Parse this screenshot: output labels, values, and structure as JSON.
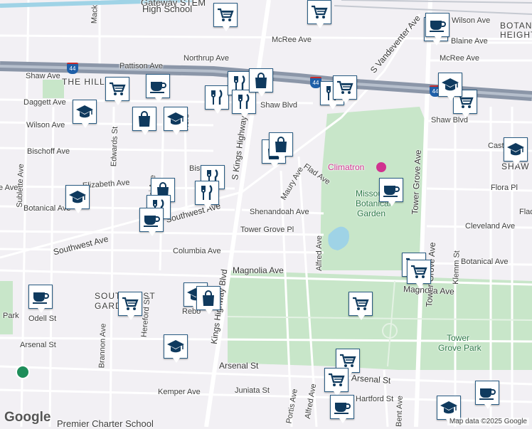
{
  "colors": {
    "background": "#f2f0f4",
    "road": "#ffffff",
    "highway": "#8b96a8",
    "park": "#c8e6c9",
    "pin_border": "#2b5d84",
    "icon": "#0f3a5e",
    "water": "#9fd3e6"
  },
  "neighborhood_labels": [
    {
      "text": "THE HILL"
    },
    {
      "text": "SOUTHWEST"
    },
    {
      "text": "GARDEN"
    },
    {
      "text": "BOTAN"
    },
    {
      "text": "HEIGHT"
    },
    {
      "text": "SHAW"
    }
  ],
  "street_labels": [
    {
      "text": "McRee Ave"
    },
    {
      "text": "Northrup Ave"
    },
    {
      "text": "Pattison Ave"
    },
    {
      "text": "Shaw Ave"
    },
    {
      "text": "Daggett Ave"
    },
    {
      "text": "Wilson Ave"
    },
    {
      "text": "Bischoff Ave"
    },
    {
      "text": "Elizabeth Ave"
    },
    {
      "text": "Botanical Ave"
    },
    {
      "text": "Southwest Ave"
    },
    {
      "text": "Southwest Ave"
    },
    {
      "text": "Columbia Ave"
    },
    {
      "text": "Tower Grove Pl"
    },
    {
      "text": "Shenandoah Ave"
    },
    {
      "text": "Magnolia Ave"
    },
    {
      "text": "Magnolia Ave"
    },
    {
      "text": "Arsenal St"
    },
    {
      "text": "Arsenal St"
    },
    {
      "text": "Arsenal St"
    },
    {
      "text": "Kemper Ave"
    },
    {
      "text": "Juniata St"
    },
    {
      "text": "Odell St"
    },
    {
      "text": "Flad Ave"
    },
    {
      "text": "Maury Ave"
    },
    {
      "text": "Shaw Blvd"
    },
    {
      "text": "Shaw Blvd"
    },
    {
      "text": "McRee Ave"
    },
    {
      "text": "Flora Pl"
    },
    {
      "text": "Cleveland Ave"
    },
    {
      "text": "Botanical Ave"
    },
    {
      "text": "Alfred Ave"
    },
    {
      "text": "Alfred Ave"
    },
    {
      "text": "Portis Ave"
    },
    {
      "text": "Hereford St"
    },
    {
      "text": "Edwards St"
    },
    {
      "text": "Brannon Ave"
    },
    {
      "text": "Marconi Ave"
    },
    {
      "text": "Sublette Ave"
    },
    {
      "text": "S Kings Highway"
    },
    {
      "text": "Kings Highway Blvd"
    },
    {
      "text": "Tower Grove Ave"
    },
    {
      "text": "Tower Grove Ave"
    },
    {
      "text": "S Vandeventer Ave"
    },
    {
      "text": "Klemm St"
    },
    {
      "text": "Bent Ave"
    },
    {
      "text": "Hartford St"
    },
    {
      "text": "Wilson Ave"
    },
    {
      "text": "Blaine Ave"
    },
    {
      "text": "Rebo"
    },
    {
      "text": "Bis"
    },
    {
      "text": "Here"
    },
    {
      "text": "Mack"
    },
    {
      "text": "Cast"
    },
    {
      "text": "Flad"
    },
    {
      "text": "Park"
    },
    {
      "text": "e Ave"
    },
    {
      "text": "e Ave"
    }
  ],
  "park_labels": [
    {
      "text": "Missouri"
    },
    {
      "text": "Botanical"
    },
    {
      "text": "Garden"
    },
    {
      "text": "Tower"
    },
    {
      "text": "Grove Park"
    }
  ],
  "poi_labels": [
    {
      "text": "Climatron"
    }
  ],
  "top_labels": [
    {
      "text": "Gateway STEM"
    },
    {
      "text": "High School"
    }
  ],
  "bottom_labels": [
    {
      "text": "Premier Charter School"
    }
  ],
  "interstate": {
    "number": "44"
  },
  "pins": [
    {
      "icon": "cart-icon"
    },
    {
      "icon": "cart-icon"
    },
    {
      "icon": "cart-icon"
    },
    {
      "icon": "coffee-icon"
    },
    {
      "icon": "cart-icon"
    },
    {
      "icon": "coffee-icon"
    },
    {
      "icon": "school-icon"
    },
    {
      "icon": "bag-icon"
    },
    {
      "icon": "school-icon"
    },
    {
      "icon": "fork-knife-icon"
    },
    {
      "icon": "fork-knife-icon"
    },
    {
      "icon": "fork-knife-icon"
    },
    {
      "icon": "bag-icon"
    },
    {
      "icon": "fork-knife-icon"
    },
    {
      "icon": "cart-icon"
    },
    {
      "icon": "school-icon"
    },
    {
      "icon": "cart-icon"
    },
    {
      "icon": "coffee-icon"
    },
    {
      "icon": "bag-icon"
    },
    {
      "icon": "bag-icon"
    },
    {
      "icon": "fork-knife-icon"
    },
    {
      "icon": "bag-icon"
    },
    {
      "icon": "fork-knife-icon"
    },
    {
      "icon": "fork-knife-icon"
    },
    {
      "icon": "coffee-icon"
    },
    {
      "icon": "school-icon"
    },
    {
      "icon": "coffee-icon"
    },
    {
      "icon": "school-icon"
    },
    {
      "icon": "cart-icon"
    },
    {
      "icon": "cart-icon"
    },
    {
      "icon": "school-icon"
    },
    {
      "icon": "bag-icon"
    },
    {
      "icon": "school-icon"
    },
    {
      "icon": "cart-icon"
    },
    {
      "icon": "cart-icon"
    },
    {
      "icon": "cart-icon"
    },
    {
      "icon": "coffee-icon"
    },
    {
      "icon": "school-icon"
    },
    {
      "icon": "coffee-icon"
    },
    {
      "icon": "coffee-icon"
    }
  ],
  "branding": {
    "logo": "Google",
    "attribution": "Map data ©2025 Google"
  }
}
